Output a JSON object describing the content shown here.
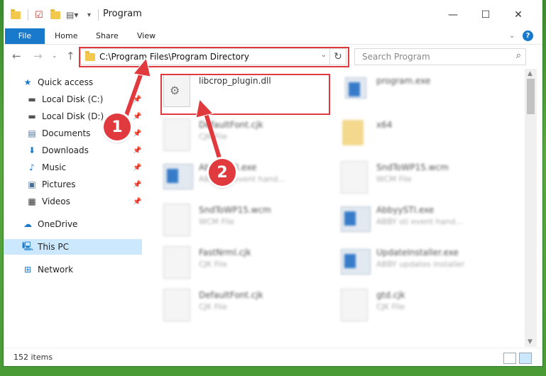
{
  "window": {
    "title": "Program",
    "controls": {
      "minimize": "—",
      "maximize": "☐",
      "close": "✕"
    }
  },
  "ribbon": {
    "tabs": [
      "File",
      "Home",
      "Share",
      "View"
    ],
    "collapse_icon": "chevron-down-icon",
    "help_icon": "help-icon"
  },
  "address": {
    "path": "C:\\Program Files\\Program Directory",
    "search_placeholder": "Search Program"
  },
  "navpane": {
    "items": [
      {
        "label": "Quick access",
        "icon": "star-icon",
        "pinned": false
      },
      {
        "label": "Local Disk (C:)",
        "icon": "drive-icon",
        "pinned": true
      },
      {
        "label": "Local Disk (D:)",
        "icon": "drive-icon",
        "pinned": true
      },
      {
        "label": "Documents",
        "icon": "documents-icon",
        "pinned": true
      },
      {
        "label": "Downloads",
        "icon": "download-icon",
        "pinned": true
      },
      {
        "label": "Music",
        "icon": "music-icon",
        "pinned": true
      },
      {
        "label": "Pictures",
        "icon": "pictures-icon",
        "pinned": true
      },
      {
        "label": "Videos",
        "icon": "videos-icon",
        "pinned": true
      },
      {
        "label": "OneDrive",
        "icon": "cloud-icon",
        "pinned": false
      },
      {
        "label": "This PC",
        "icon": "computer-icon",
        "pinned": false,
        "selected": true
      },
      {
        "label": "Network",
        "icon": "network-icon",
        "pinned": false
      }
    ]
  },
  "files": [
    {
      "name": "libcrop_plugin.dll",
      "type": "",
      "kind": "dll",
      "highlighted": true
    },
    {
      "name": "program.exe",
      "type": "",
      "kind": "exe"
    },
    {
      "name": "DefaultFont.cjk",
      "type": "CJK File",
      "kind": "doc"
    },
    {
      "name": "x64",
      "type": "",
      "kind": "folder"
    },
    {
      "name": "AbbyySTI.exe",
      "type": "ABBY sti event hand...",
      "kind": "exe"
    },
    {
      "name": "SndToWP15.wcm",
      "type": "WCM File",
      "kind": "doc"
    },
    {
      "name": "SndToWP15.wcm",
      "type": "WCM File",
      "kind": "doc"
    },
    {
      "name": "AbbyySTI.exe",
      "type": "ABBY sti event hand...",
      "kind": "exe"
    },
    {
      "name": "FastNrml.cjk",
      "type": "CJK File",
      "kind": "doc"
    },
    {
      "name": "UpdateInstaller.exe",
      "type": "ABBY updates installer",
      "kind": "exe"
    },
    {
      "name": "DefaultFont.cjk",
      "type": "CJK File",
      "kind": "doc"
    },
    {
      "name": "gtd.cjk",
      "type": "CJK File",
      "kind": "doc"
    }
  ],
  "status": {
    "count": "152 items"
  },
  "callouts": {
    "one": "1",
    "two": "2"
  },
  "colors": {
    "accent": "#1979ca",
    "highlight": "#e0393e",
    "selected": "#cce8ff"
  }
}
